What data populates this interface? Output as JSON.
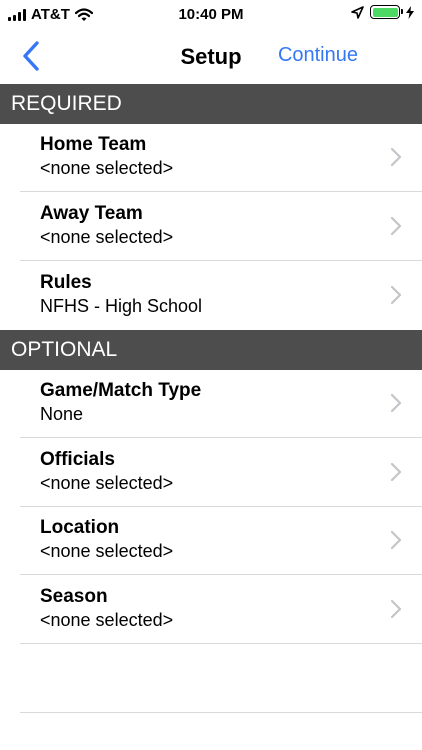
{
  "status_bar": {
    "carrier": "AT&T",
    "time": "10:40 PM",
    "battery_color": "#4cd964"
  },
  "nav": {
    "title": "Setup",
    "continue_label": "Continue",
    "accent_color": "#3478f6"
  },
  "sections": {
    "required": {
      "header": "REQUIRED",
      "rows": [
        {
          "title": "Home Team",
          "value": "<none selected>"
        },
        {
          "title": "Away Team",
          "value": "<none selected>"
        },
        {
          "title": "Rules",
          "value": "NFHS - High School"
        }
      ]
    },
    "optional": {
      "header": "OPTIONAL",
      "rows": [
        {
          "title": "Game/Match Type",
          "value": "None"
        },
        {
          "title": "Officials",
          "value": "<none selected>"
        },
        {
          "title": "Location",
          "value": "<none selected>"
        },
        {
          "title": "Season",
          "value": "<none selected>"
        }
      ]
    }
  }
}
